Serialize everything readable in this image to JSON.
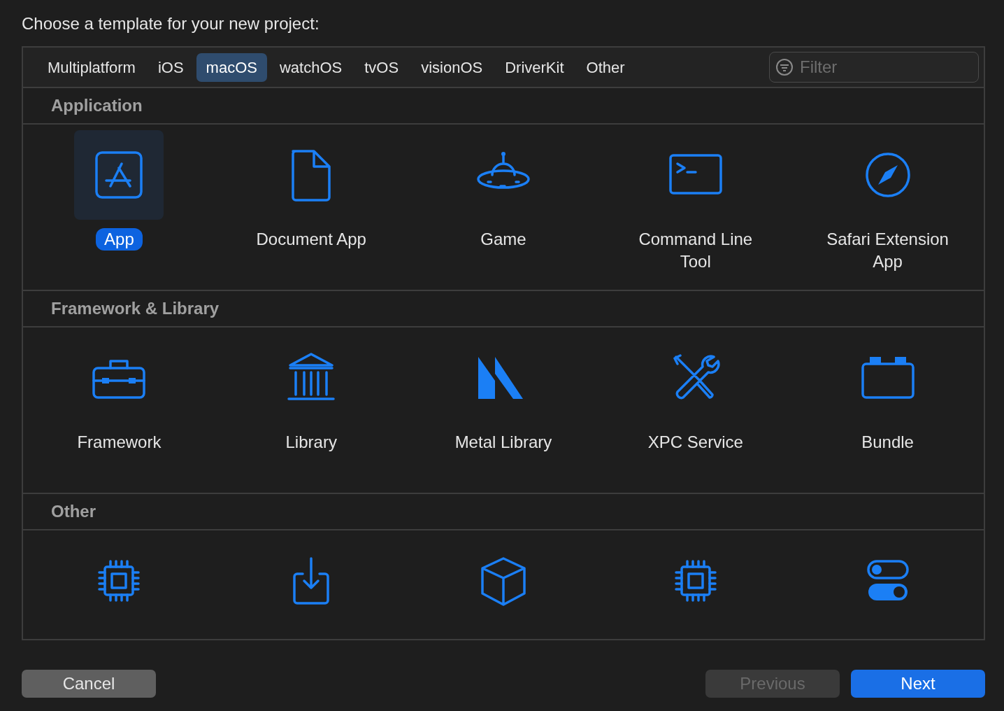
{
  "heading": "Choose a template for your new project:",
  "tabs": [
    {
      "label": "Multiplatform",
      "selected": false
    },
    {
      "label": "iOS",
      "selected": false
    },
    {
      "label": "macOS",
      "selected": true
    },
    {
      "label": "watchOS",
      "selected": false
    },
    {
      "label": "tvOS",
      "selected": false
    },
    {
      "label": "visionOS",
      "selected": false
    },
    {
      "label": "DriverKit",
      "selected": false
    },
    {
      "label": "Other",
      "selected": false
    }
  ],
  "filter": {
    "placeholder": "Filter"
  },
  "sections": [
    {
      "title": "Application",
      "items": [
        {
          "label": "App",
          "selected": true
        },
        {
          "label": "Document App",
          "selected": false
        },
        {
          "label": "Game",
          "selected": false
        },
        {
          "label": "Command Line Tool",
          "selected": false
        },
        {
          "label": "Safari Extension App",
          "selected": false
        }
      ]
    },
    {
      "title": "Framework & Library",
      "items": [
        {
          "label": "Framework",
          "selected": false
        },
        {
          "label": "Library",
          "selected": false
        },
        {
          "label": "Metal Library",
          "selected": false
        },
        {
          "label": "XPC Service",
          "selected": false
        },
        {
          "label": "Bundle",
          "selected": false
        }
      ]
    },
    {
      "title": "Other",
      "items": [
        {
          "selected": false
        },
        {
          "selected": false
        },
        {
          "selected": false
        },
        {
          "selected": false
        },
        {
          "selected": false
        }
      ]
    }
  ],
  "buttons": [
    {
      "label": "Cancel",
      "kind": "default",
      "disabled": false
    },
    {
      "label": "Previous",
      "kind": "default",
      "disabled": true
    },
    {
      "label": "Next",
      "kind": "primary",
      "disabled": false
    }
  ]
}
